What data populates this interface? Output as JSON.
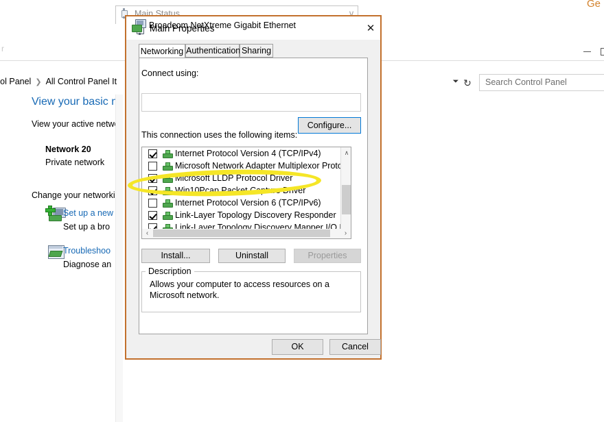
{
  "background_window": {
    "tab_label_fragment": "r",
    "breadcrumb": [
      "rol Panel",
      "All Control Panel It"
    ],
    "search": {
      "placeholder": "Search Control Panel"
    },
    "heading": "View your basic n",
    "subheading": "View your active netwo",
    "network_name": "Network 20",
    "network_type": "Private network",
    "change_settings_label": "Change your networki",
    "tasks": [
      {
        "title": "Set up a new",
        "description": "Set up a bro",
        "icon": "new-connection-icon"
      },
      {
        "title": "Troubleshoo",
        "description": "Diagnose an",
        "icon": "troubleshoot-icon"
      }
    ],
    "window_controls": {
      "minimize": "minimize-icon",
      "maximize": "maximize-icon"
    },
    "corner_text": "Ge"
  },
  "status_window": {
    "title": "Main Status",
    "close_label": "∨",
    "icon": "network-plug-icon"
  },
  "dialog": {
    "title": "Main Properties",
    "icon": "network-plug-icon",
    "close_label": "✕",
    "border_color": "#c2702c",
    "tabs": [
      {
        "label": "Networking",
        "active": true
      },
      {
        "label": "Authentication",
        "active": false
      },
      {
        "label": "Sharing",
        "active": false
      }
    ],
    "connect_using_label": "Connect using:",
    "adapter": {
      "name": "Broadcom NetXtreme Gigabit Ethernet",
      "icon": "network-adapter-icon"
    },
    "configure_button": "Configure...",
    "items_label": "This connection uses the following items:",
    "items": [
      {
        "label": "Internet Protocol Version 4 (TCP/IPv4)",
        "checked": true
      },
      {
        "label": "Microsoft Network Adapter Multiplexor Protocol",
        "checked": false
      },
      {
        "label": "Microsoft LLDP Protocol Driver",
        "checked": true
      },
      {
        "label": "Win10Pcap Packet Capture Driver",
        "checked": true
      },
      {
        "label": "Internet Protocol Version 6 (TCP/IPv6)",
        "checked": false
      },
      {
        "label": "Link-Layer Topology Discovery Responder",
        "checked": true
      },
      {
        "label": "Link-Layer Topology Discovery Mapper I/O Driver",
        "checked": true
      }
    ],
    "scrollbars": {
      "vertical_up": "∧",
      "vertical_down": "∨",
      "horizontal_left": "‹",
      "horizontal_right": "›"
    },
    "action_buttons": {
      "install": "Install...",
      "uninstall": "Uninstall",
      "properties": "Properties"
    },
    "description": {
      "legend": "Description",
      "text": "Allows your computer to access resources on a Microsoft network."
    },
    "footer_buttons": {
      "ok": "OK",
      "cancel": "Cancel"
    }
  },
  "annotation": {
    "type": "ellipse-highlight",
    "color": "#f5e627",
    "targets_item": "Internet Protocol Version 6 (TCP/IPv6)"
  }
}
